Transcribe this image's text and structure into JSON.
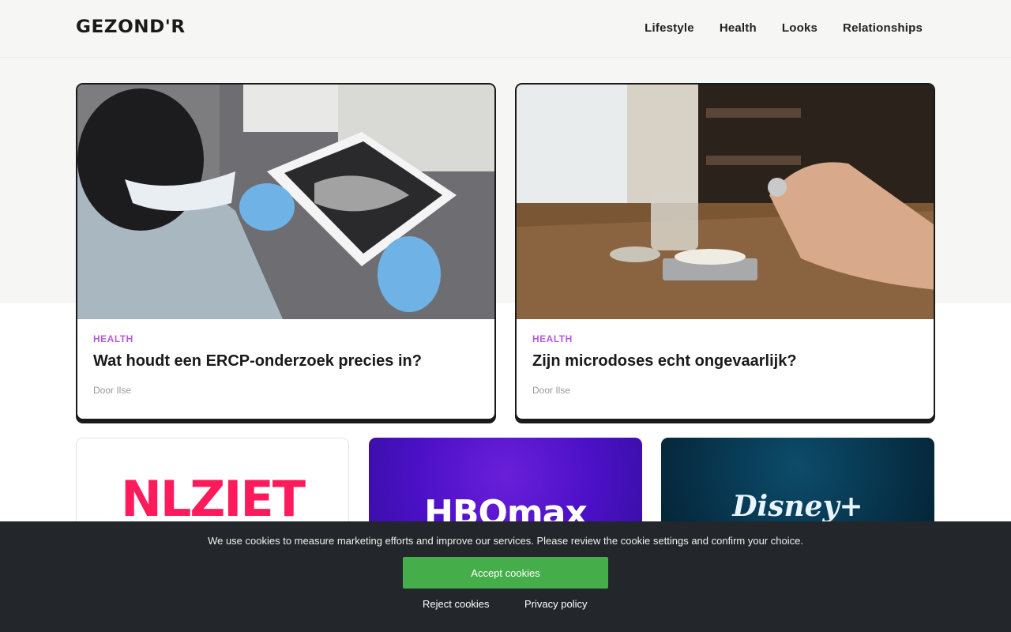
{
  "header": {
    "logo": "GEZOND'R",
    "nav": [
      "Lifestyle",
      "Health",
      "Looks",
      "Relationships"
    ]
  },
  "cards": [
    {
      "category": "HEALTH",
      "title": "Wat houdt een ERCP-onderzoek precies in?",
      "author": "Door Ilse",
      "image": "dentist-xray-tablet-photo"
    },
    {
      "category": "HEALTH",
      "title": "Zijn microdoses echt ongevaarlijk?",
      "author": "Door Ilse",
      "image": "microdose-scale-photo"
    }
  ],
  "tiles": [
    {
      "brand": "NLZIET"
    },
    {
      "brand": "HBOmax"
    },
    {
      "brand": "Disney+"
    }
  ],
  "cookie": {
    "message": "We use cookies to measure marketing efforts and improve our services. Please review the cookie settings and confirm your choice.",
    "accept": "Accept cookies",
    "reject": "Reject cookies",
    "privacy": "Privacy policy"
  },
  "colors": {
    "category": "#b35bd8",
    "accept": "#45ae4a",
    "banner": "#23272b",
    "band": "#f6f6f4"
  }
}
